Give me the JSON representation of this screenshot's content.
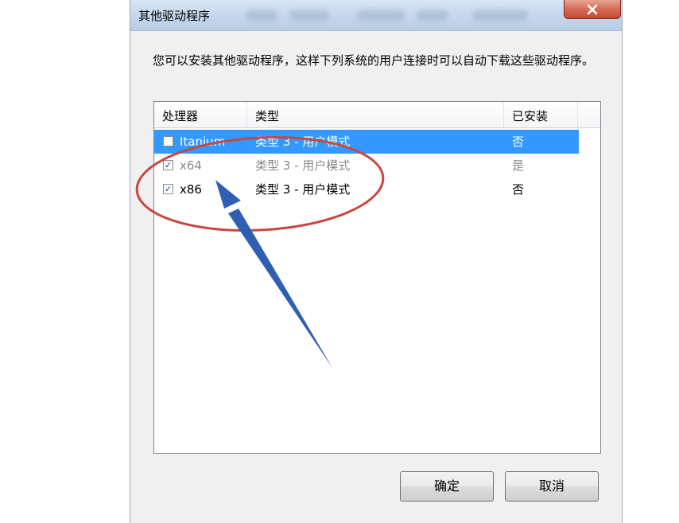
{
  "window": {
    "title": "其他驱动程序",
    "close_icon": "close-icon"
  },
  "description": "您可以安装其他驱动程序，这样下列系统的用户连接时可以自动下载这些驱动程序。",
  "list": {
    "columns": [
      "处理器",
      "类型",
      "已安装"
    ],
    "rows": [
      {
        "checked": false,
        "processor": "Itanium",
        "type": "类型 3 - 用户模式",
        "installed": "否",
        "selected": true
      },
      {
        "checked": true,
        "processor": "x64",
        "type": "类型 3 - 用户模式",
        "installed": "是",
        "selected": false,
        "disabled": true
      },
      {
        "checked": true,
        "processor": "x86",
        "type": "类型 3 - 用户模式",
        "installed": "否",
        "selected": false
      }
    ]
  },
  "buttons": {
    "ok": "确定",
    "cancel": "取消"
  },
  "colors": {
    "selection": "#3399ff",
    "annotation_circle": "#c8473f",
    "annotation_arrow": "#2f5fb3"
  }
}
